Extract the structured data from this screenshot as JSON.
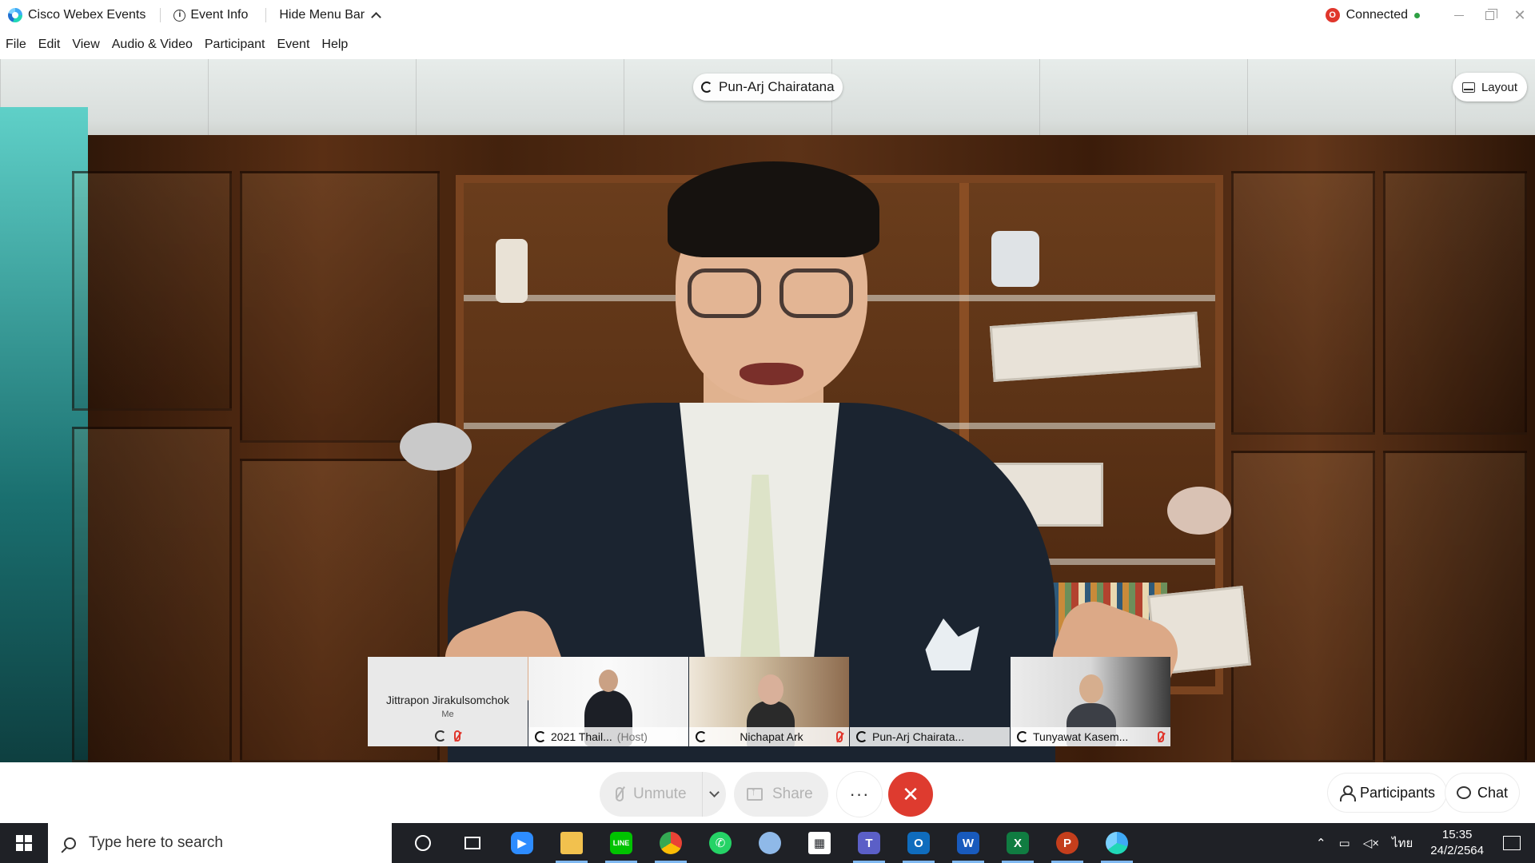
{
  "titlebar": {
    "app_name": "Cisco Webex Events",
    "event_info": "Event Info",
    "hide_menu_bar": "Hide Menu Bar",
    "status_badge": "O",
    "status": "Connected",
    "status_color": "#2ea043"
  },
  "menu": [
    "File",
    "Edit",
    "View",
    "Audio & Video",
    "Participant",
    "Event",
    "Help"
  ],
  "stage": {
    "active_speaker": "Pun-Arj Chairatana",
    "layout_label": "Layout"
  },
  "filmstrip": [
    {
      "name": "Jittrapon Jirakulsomchok",
      "sub": "Me"
    },
    {
      "name": "2021 Thail...",
      "tag": "(Host)"
    },
    {
      "name": "Nichapat Ark"
    },
    {
      "name": "Pun-Arj Chairata..."
    },
    {
      "name": "Tunyawat Kasem..."
    }
  ],
  "controls": {
    "unmute": "Unmute",
    "share": "Share",
    "more": "···",
    "leave": "✕",
    "participants": "Participants",
    "chat": "Chat",
    "leave_color": "#de3b2f"
  },
  "taskbar": {
    "search_placeholder": "Type here to search",
    "apps": [
      "cortana-icon",
      "task-view-icon",
      "zoom-icon",
      "file-explorer-icon",
      "line-icon",
      "chrome-icon",
      "whatsapp-icon",
      "paint-icon",
      "store-icon",
      "teams-icon",
      "outlook-icon",
      "word-icon",
      "excel-icon",
      "powerpoint-icon",
      "webex-icon"
    ],
    "tray_lang": "ไทย",
    "time": "15:35",
    "date": "24/2/2564"
  }
}
